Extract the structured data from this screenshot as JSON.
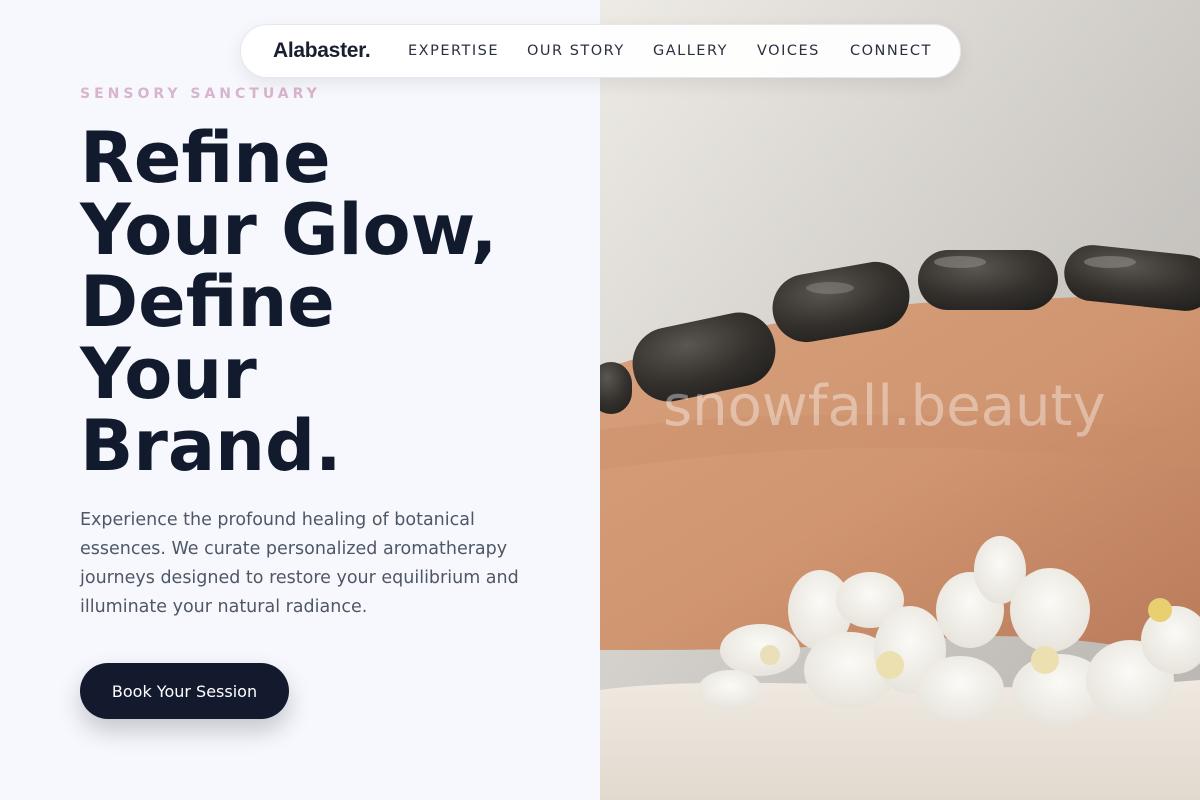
{
  "nav": {
    "brand": "Alabaster.",
    "links": [
      "EXPERTISE",
      "OUR STORY",
      "GALLERY",
      "VOICES",
      "CONNECT"
    ]
  },
  "hero": {
    "eyebrow": "SENSORY SANCTUARY",
    "headline": [
      "Refine",
      "Your Glow,",
      "Define",
      "Your",
      "Brand."
    ],
    "body": "Experience the profound healing of botanical essences. We curate personalized aromatherapy journeys designed to restore your equilibrium and illuminate your natural radiance.",
    "cta_label": "Book Your Session"
  },
  "image": {
    "subject": "hot stone massage with white orchids",
    "watermark": "snowfall.beauty"
  },
  "colors": {
    "background": "#f7f8fd",
    "headline": "#121a2e",
    "eyebrow": "#d9b4cf",
    "body": "#4f5766",
    "cta_bg": "#131a2e",
    "cta_text": "#ffffff"
  }
}
